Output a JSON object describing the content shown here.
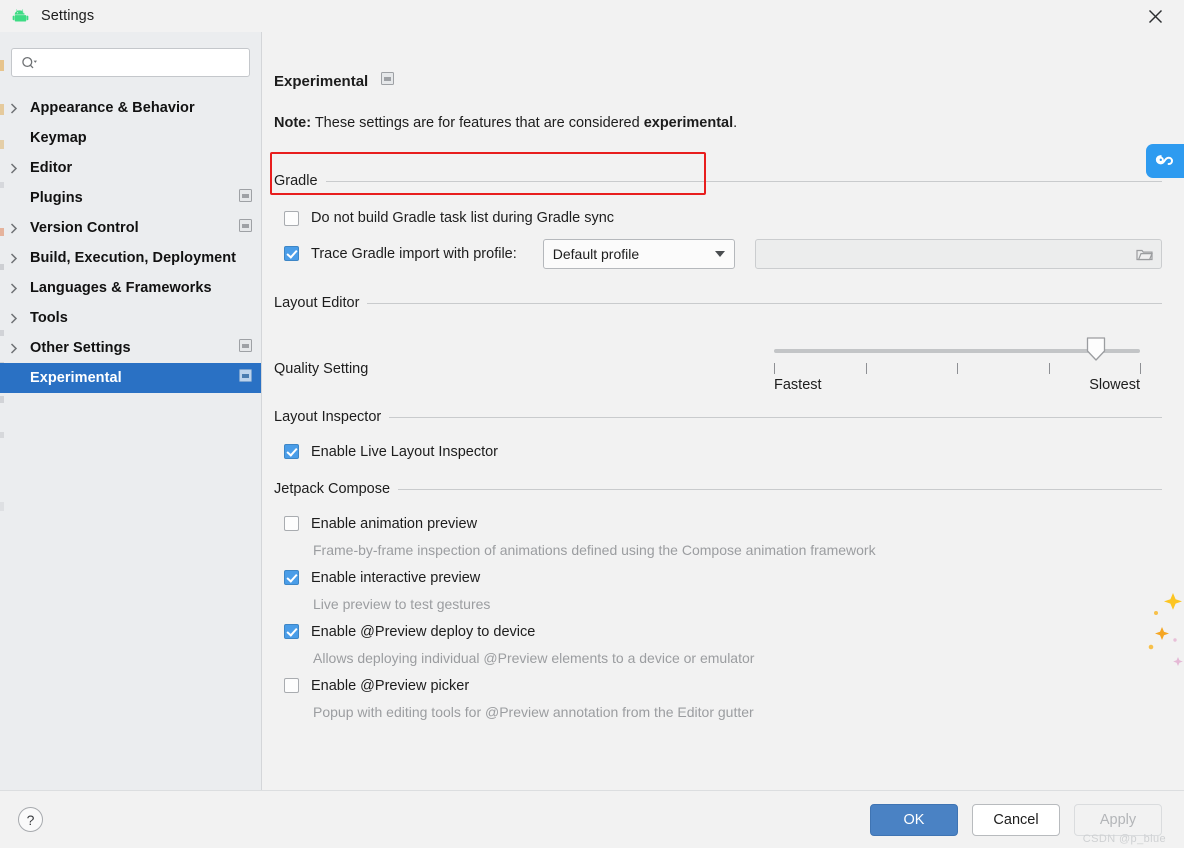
{
  "window": {
    "title": "Settings",
    "app_icon": "android-robot-icon",
    "close_icon": "close-icon"
  },
  "sidebar": {
    "search": {
      "placeholder": "",
      "value": "",
      "icon": "search-icon"
    },
    "items": [
      {
        "label": "Appearance & Behavior",
        "arrow": true,
        "panel_icon": false,
        "selected": false
      },
      {
        "label": "Keymap",
        "arrow": false,
        "panel_icon": false,
        "selected": false
      },
      {
        "label": "Editor",
        "arrow": true,
        "panel_icon": false,
        "selected": false
      },
      {
        "label": "Plugins",
        "arrow": false,
        "panel_icon": true,
        "selected": false
      },
      {
        "label": "Version Control",
        "arrow": true,
        "panel_icon": true,
        "selected": false
      },
      {
        "label": "Build, Execution, Deployment",
        "arrow": true,
        "panel_icon": false,
        "selected": false
      },
      {
        "label": "Languages & Frameworks",
        "arrow": true,
        "panel_icon": false,
        "selected": false
      },
      {
        "label": "Tools",
        "arrow": true,
        "panel_icon": false,
        "selected": false
      },
      {
        "label": "Other Settings",
        "arrow": true,
        "panel_icon": true,
        "selected": false
      },
      {
        "label": "Experimental",
        "arrow": false,
        "panel_icon": true,
        "selected": true
      }
    ]
  },
  "main": {
    "page_title": "Experimental",
    "page_title_icon": "panel-icon",
    "note_prefix": "Note:",
    "note_text": " These settings are for features that are considered ",
    "note_bold": "experimental",
    "note_suffix": ".",
    "groups": {
      "gradle": {
        "label": "Gradle",
        "do_not_build": {
          "label": "Do not build Gradle task list during Gradle sync",
          "checked": false,
          "highlighted": true
        },
        "trace": {
          "label": "Trace Gradle import with profile:",
          "checked": true,
          "profile_selected": "Default profile",
          "profile_options": [
            "Default profile"
          ],
          "path_value": "",
          "path_placeholder": "",
          "path_enabled": false,
          "browse_icon": "folder-icon"
        }
      },
      "layout_editor": {
        "label": "Layout Editor",
        "quality_label": "Quality Setting",
        "slider": {
          "min_label": "Fastest",
          "max_label": "Slowest",
          "ticks": 5,
          "value_percent": 85
        }
      },
      "layout_inspector": {
        "label": "Layout Inspector",
        "items": [
          {
            "label": "Enable Live Layout Inspector",
            "checked": true,
            "desc": ""
          }
        ]
      },
      "jetpack_compose": {
        "label": "Jetpack Compose",
        "items": [
          {
            "label": "Enable animation preview",
            "checked": false,
            "desc": "Frame-by-frame inspection of animations defined using the Compose animation framework"
          },
          {
            "label": "Enable interactive preview",
            "checked": true,
            "desc": "Live preview to test gestures"
          },
          {
            "label": "Enable @Preview deploy to device",
            "checked": true,
            "desc": "Allows deploying individual @Preview elements to a device or emulator"
          },
          {
            "label": "Enable @Preview picker",
            "checked": false,
            "desc": "Popup with editing tools for @Preview annotation from the Editor gutter"
          }
        ]
      }
    },
    "side_badge": {
      "icon": "loop-badge-icon",
      "color": "#2e9bf0"
    }
  },
  "footer": {
    "help_label": "?",
    "ok_label": "OK",
    "cancel_label": "Cancel",
    "apply_label": "Apply",
    "watermark": "CSDN @p_blue"
  },
  "colors": {
    "accent_blue": "#2a71c4",
    "checkbox_blue": "#4a9de8",
    "ok_blue": "#4a82c4",
    "highlight_red": "#e81e1e",
    "sidebar_bg": "#ebedef",
    "content_bg": "#f2f2f2",
    "android_green": "#3ddc84"
  }
}
